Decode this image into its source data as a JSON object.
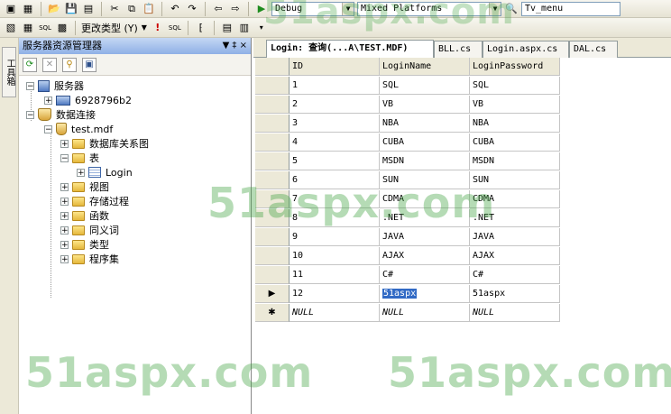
{
  "toolbar1": {
    "config_combo": "Debug",
    "platform_combo": "Mixed Platforms",
    "find_combo": "Tv_menu"
  },
  "toolbar2": {
    "change_type_label": "更改类型 (Y)"
  },
  "left_strip": {
    "toolbox_label": "工具箱"
  },
  "server_explorer": {
    "title": "服务器资源管理器",
    "title_controls": "▼ ‡ ×",
    "tree": {
      "servers": "服务器",
      "server_name": "6928796b2",
      "data_connections": "数据连接",
      "db": "test.mdf",
      "diagrams": "数据库关系图",
      "tables": "表",
      "login_table": "Login",
      "views": "视图",
      "procs": "存储过程",
      "functions": "函数",
      "synonyms": "同义词",
      "types": "类型",
      "assemblies": "程序集"
    }
  },
  "tabs": [
    {
      "label": "Login: 查询(...A\\TEST.MDF)"
    },
    {
      "label": "BLL.cs"
    },
    {
      "label": "Login.aspx.cs"
    },
    {
      "label": "DAL.cs"
    }
  ],
  "grid": {
    "columns": [
      "ID",
      "LoginName",
      "LoginPassword"
    ],
    "rows": [
      [
        "1",
        "SQL",
        "SQL"
      ],
      [
        "2",
        "VB",
        "VB"
      ],
      [
        "3",
        "NBA",
        "NBA"
      ],
      [
        "4",
        "CUBA",
        "CUBA"
      ],
      [
        "5",
        "MSDN",
        "MSDN"
      ],
      [
        "6",
        "SUN",
        "SUN"
      ],
      [
        "7",
        "CDMA",
        "CDMA"
      ],
      [
        "8",
        ".NET",
        ".NET"
      ],
      [
        "9",
        "JAVA",
        "JAVA"
      ],
      [
        "10",
        "AJAX",
        "AJAX"
      ],
      [
        "11",
        "C#",
        "C#"
      ],
      [
        "12",
        "51aspx",
        "51aspx"
      ],
      [
        "NULL",
        "NULL",
        "NULL"
      ]
    ],
    "current_marker": "▶",
    "new_marker": "✱"
  },
  "watermark": "51aspx.com"
}
